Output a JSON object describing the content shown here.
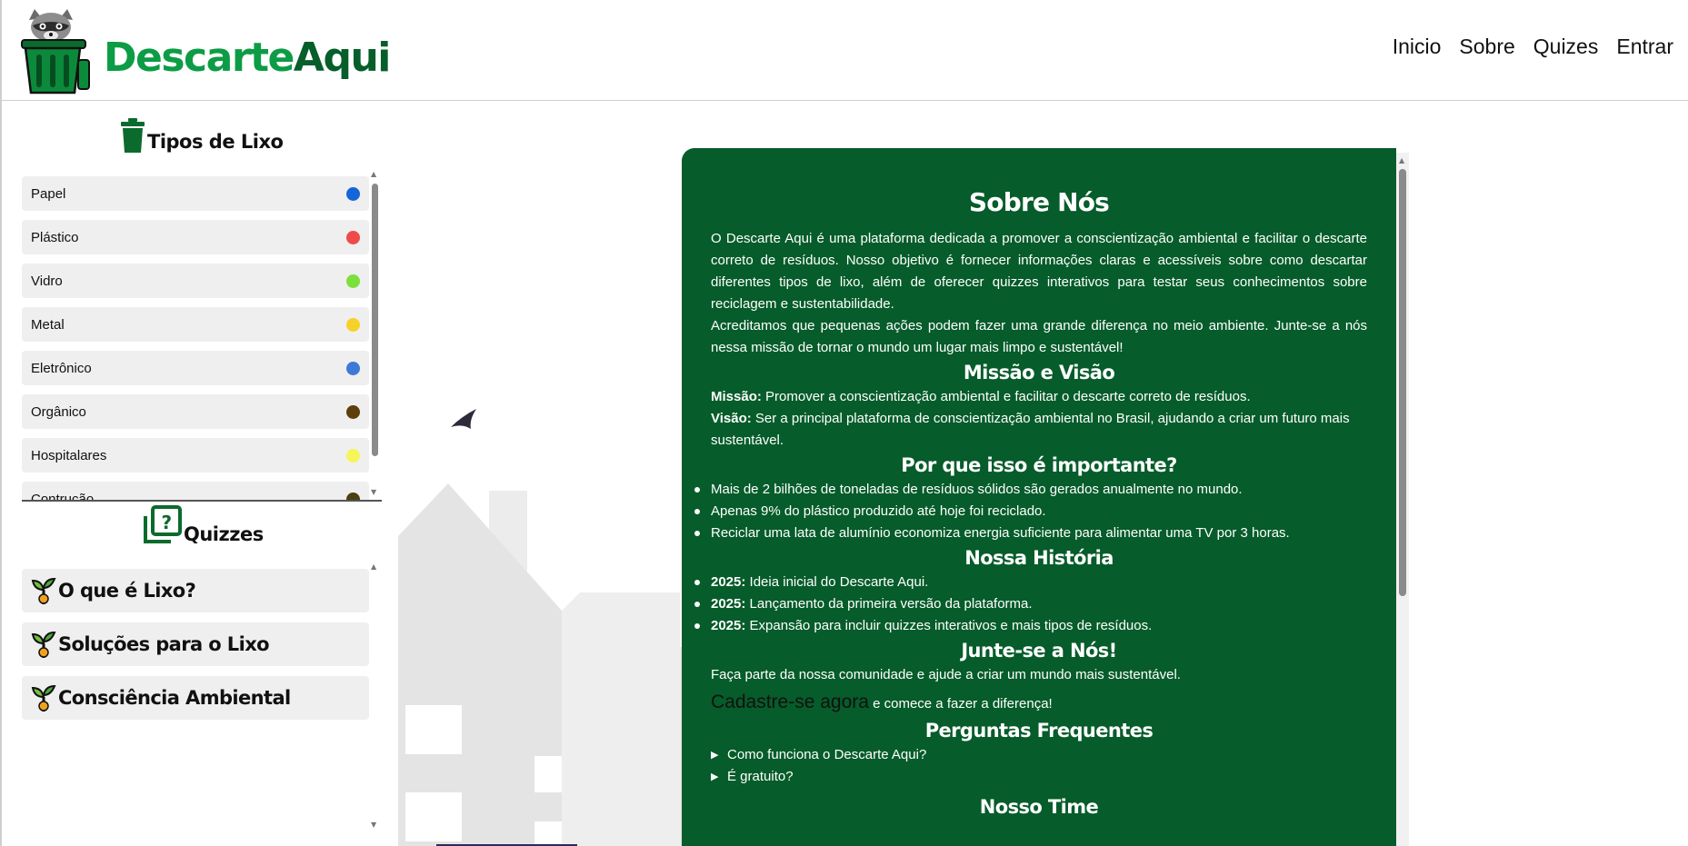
{
  "header": {
    "brand_part1": "Descarte",
    "brand_part2": "Aqui",
    "nav": [
      "Inicio",
      "Sobre",
      "Quizes",
      "Entrar"
    ]
  },
  "sidebar": {
    "tipos_title": "Tipos de Lixo",
    "tipos": [
      {
        "label": "Papel",
        "color": "#1465d8"
      },
      {
        "label": "Plástico",
        "color": "#f04a4a"
      },
      {
        "label": "Vidro",
        "color": "#7be03c"
      },
      {
        "label": "Metal",
        "color": "#f6d12a"
      },
      {
        "label": "Eletrônico",
        "color": "#3c7ad6"
      },
      {
        "label": "Orgânico",
        "color": "#5e3f0c"
      },
      {
        "label": "Hospitalares",
        "color": "#f6f55a"
      },
      {
        "label": "Contrução",
        "color": "#4a4010"
      }
    ],
    "quiz_title": "Quizzes",
    "quizzes": [
      "O que é Lixo?",
      "Soluções para o Lixo",
      "Consciência Ambiental"
    ]
  },
  "about": {
    "title": "Sobre Nós",
    "intro1": "O Descarte Aqui é uma plataforma dedicada a promover a conscientização ambiental e facilitar o descarte correto de resíduos. Nosso objetivo é fornecer informações claras e acessíveis sobre como descartar diferentes tipos de lixo, além de oferecer quizzes interativos para testar seus conhecimentos sobre reciclagem e sustentabilidade.",
    "intro2": "Acreditamos que pequenas ações podem fazer uma grande diferença no meio ambiente. Junte-se a nós nessa missão de tornar o mundo um lugar mais limpo e sustentável!",
    "mission_title": "Missão e Visão",
    "mission_label": "Missão:",
    "mission_text": " Promover a conscientização ambiental e facilitar o descarte correto de resíduos.",
    "vision_label": "Visão:",
    "vision_text": " Ser a principal plataforma de conscientização ambiental no Brasil, ajudando a criar um futuro mais sustentável.",
    "why_title": "Por que isso é importante?",
    "why": [
      "Mais de 2 bilhões de toneladas de resíduos sólidos são gerados anualmente no mundo.",
      "Apenas 9% do plástico produzido até hoje foi reciclado.",
      "Reciclar uma lata de alumínio economiza energia suficiente para alimentar uma TV por 3 horas."
    ],
    "history_title": "Nossa História",
    "history": [
      {
        "year": "2025:",
        "text": " Ideia inicial do Descarte Aqui."
      },
      {
        "year": "2025:",
        "text": " Lançamento da primeira versão da plataforma."
      },
      {
        "year": "2025:",
        "text": " Expansão para incluir quizzes interativos e mais tipos de resíduos."
      }
    ],
    "join_title": "Junte-se a Nós!",
    "join_text": "Faça parte da nossa comunidade e ajude a criar um mundo mais sustentável.",
    "join_link": "Cadastre-se agora",
    "join_after": " e comece a fazer a diferença!",
    "faq_title": "Perguntas Frequentes",
    "faq": [
      "Como funciona o Descarte Aqui?",
      "É gratuito?"
    ],
    "team_title": "Nosso Time"
  }
}
